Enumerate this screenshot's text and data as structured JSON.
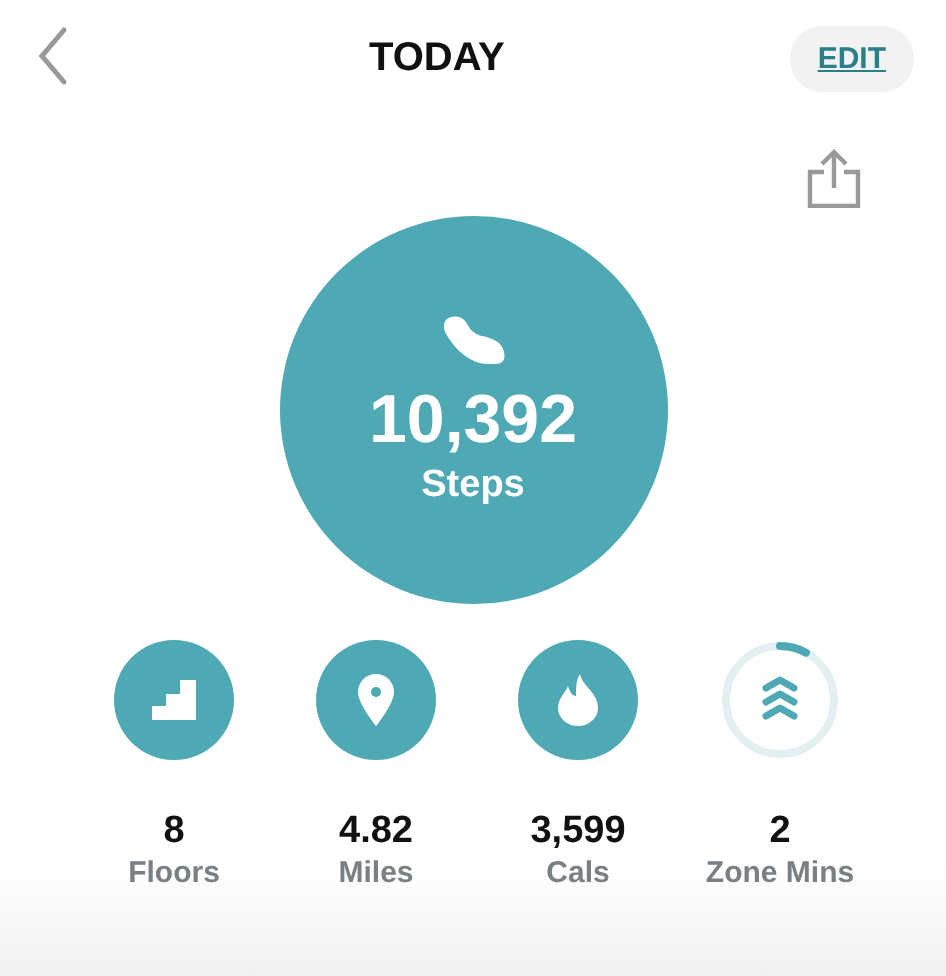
{
  "header": {
    "title": "TODAY",
    "edit_button": "EDIT"
  },
  "steps": {
    "value": "10,392",
    "label": "Steps"
  },
  "stats": [
    {
      "kind": "stairs",
      "value": "8",
      "label": "Floors"
    },
    {
      "kind": "pin",
      "value": "4.82",
      "label": "Miles"
    },
    {
      "kind": "flame",
      "value": "3,599",
      "label": "Cals"
    },
    {
      "kind": "zone",
      "value": "2",
      "label": "Zone Mins",
      "level": 0.08
    }
  ]
}
